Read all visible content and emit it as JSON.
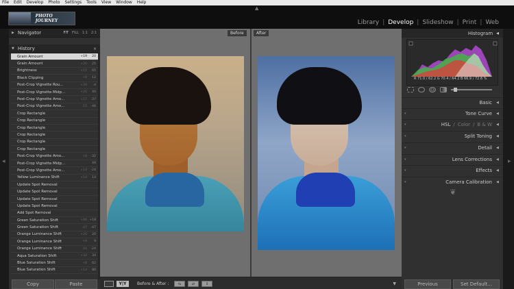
{
  "menubar": {
    "items": [
      "File",
      "Edit",
      "Develop",
      "Photo",
      "Settings",
      "Tools",
      "View",
      "Window",
      "Help"
    ]
  },
  "logo": {
    "text": "PHOTO JOURNEY"
  },
  "modules": {
    "library": "Library",
    "develop": "Develop",
    "slideshow": "Slideshow",
    "print": "Print",
    "web": "Web",
    "active": "Develop"
  },
  "left_panel": {
    "navigator": {
      "title": "Navigator",
      "zoom": [
        "FIT",
        "FILL",
        "1:1",
        "2:1"
      ]
    },
    "history": {
      "title": "History",
      "close": "×",
      "items": [
        {
          "label": "Grain Amount",
          "v1": "+19",
          "v2": "20"
        },
        {
          "label": "Grain Amount",
          "v1": "+20",
          "v2": "25"
        },
        {
          "label": "Brightness",
          "v1": "+15",
          "v2": "65"
        },
        {
          "label": "Black Clipping",
          "v1": "+8",
          "v2": "12"
        },
        {
          "label": "Post-Crop Vignette Rou...",
          "v1": "+30",
          "v2": "-4"
        },
        {
          "label": "Post-Crop Vignette Midp...",
          "v1": "+20",
          "v2": "40"
        },
        {
          "label": "Post-Crop Vignette Amo...",
          "v1": "+17",
          "v2": "-37"
        },
        {
          "label": "Post-Crop Vignette Amo...",
          "v1": "-15",
          "v2": "-46"
        },
        {
          "label": "Crop Rectangle",
          "v1": "",
          "v2": ""
        },
        {
          "label": "Crop Rectangle",
          "v1": "",
          "v2": ""
        },
        {
          "label": "Crop Rectangle",
          "v1": "",
          "v2": ""
        },
        {
          "label": "Crop Rectangle",
          "v1": "",
          "v2": ""
        },
        {
          "label": "Crop Rectangle",
          "v1": "",
          "v2": ""
        },
        {
          "label": "Crop Rectangle",
          "v1": "",
          "v2": ""
        },
        {
          "label": "Post-Crop Vignette Amo...",
          "v1": "+8",
          "v2": "-32"
        },
        {
          "label": "Post-Crop Vignette Midp...",
          "v1": "",
          "v2": "49"
        },
        {
          "label": "Post-Crop Vignette Amo...",
          "v1": "+14",
          "v2": "-24"
        },
        {
          "label": "Yellow Luminance Shift",
          "v1": "+14",
          "v2": "14"
        },
        {
          "label": "Update Spot Removal",
          "v1": "",
          "v2": ""
        },
        {
          "label": "Update Spot Removal",
          "v1": "",
          "v2": ""
        },
        {
          "label": "Update Spot Removal",
          "v1": "",
          "v2": ""
        },
        {
          "label": "Update Spot Removal",
          "v1": "",
          "v2": ""
        },
        {
          "label": "Add Spot Removal",
          "v1": "",
          "v2": ""
        },
        {
          "label": "Green Saturation Shift",
          "v1": "+46",
          "v2": "+18"
        },
        {
          "label": "Green Saturation Shift",
          "v1": "-47",
          "v2": "-47"
        },
        {
          "label": "Orange Luminance Shift",
          "v1": "+20",
          "v2": "20"
        },
        {
          "label": "Orange Luminance Shift",
          "v1": "+9",
          "v2": "9"
        },
        {
          "label": "Orange Luminance Shift",
          "v1": "-24",
          "v2": "-24"
        },
        {
          "label": "Aqua Saturation Shift",
          "v1": "+34",
          "v2": "34"
        },
        {
          "label": "Blue Saturation Shift",
          "v1": "+8",
          "v2": "62"
        },
        {
          "label": "Blue Saturation Shift",
          "v1": "+14",
          "v2": "80"
        }
      ]
    },
    "copy": "Copy",
    "paste": "Paste"
  },
  "center": {
    "before_tag": "Before",
    "after_tag": "After",
    "toolbar": {
      "yy": "Y|Y",
      "label": "Before & After :"
    }
  },
  "right_panel": {
    "histogram": {
      "title": "Histogram",
      "readout": "R 71.0 / 62.2  G 70.4 / 64.2  B 66.9 / 72.8 %"
    },
    "sections": {
      "basic": "Basic",
      "tone_curve": "Tone Curve",
      "hsl": "HSL",
      "color": "Color",
      "bw": "B & W",
      "split_toning": "Split Toning",
      "detail": "Detail",
      "lens_corrections": "Lens Corrections",
      "effects": "Effects",
      "camera_calibration": "Camera Calibration"
    },
    "previous": "Previous",
    "set_default": "Set Default..."
  },
  "colors": {
    "selected_row": "#d8d8d8",
    "panel_bg": "#303030",
    "canvas_bg": "#6f6f6f"
  }
}
